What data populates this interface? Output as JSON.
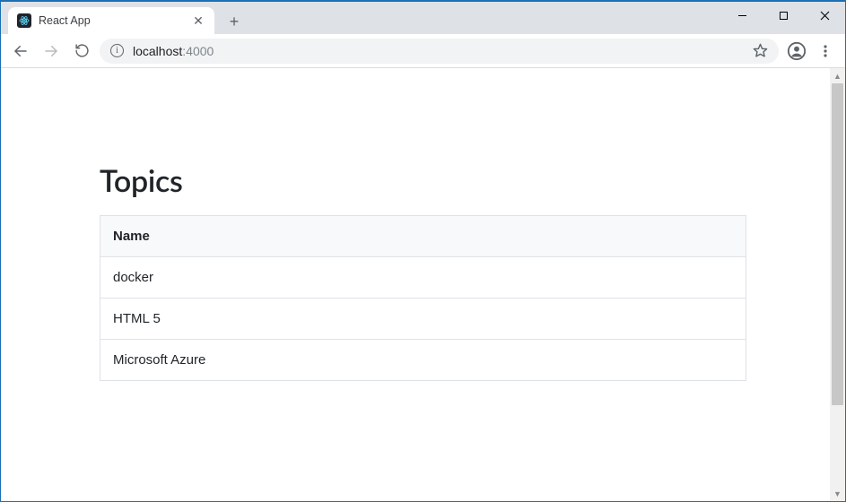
{
  "browser": {
    "tab_title": "React App",
    "url_host": "localhost",
    "url_port": ":4000"
  },
  "page": {
    "heading": "Topics",
    "column_header": "Name",
    "rows": [
      {
        "name": "docker"
      },
      {
        "name": "HTML 5"
      },
      {
        "name": "Microsoft Azure"
      }
    ]
  }
}
